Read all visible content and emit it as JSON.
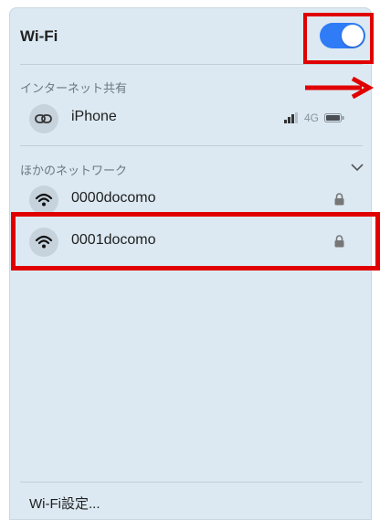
{
  "header": {
    "title": "Wi-Fi",
    "toggle_on": true
  },
  "hotspot": {
    "section_label": "インターネット共有",
    "device": {
      "name": "iPhone",
      "network_type": "4G",
      "icon": "link-icon"
    }
  },
  "other_networks": {
    "section_label": "ほかのネットワーク",
    "networks": [
      {
        "name": "0000docomo",
        "secured": true,
        "icon": "wifi-icon"
      },
      {
        "name": "0001docomo",
        "secured": true,
        "icon": "wifi-icon"
      }
    ]
  },
  "footer": {
    "settings_label": "Wi-Fi設定..."
  },
  "colors": {
    "toggle_on": "#2f7cf6",
    "highlight": "#e00000",
    "panel_bg": "#dce9f2"
  }
}
